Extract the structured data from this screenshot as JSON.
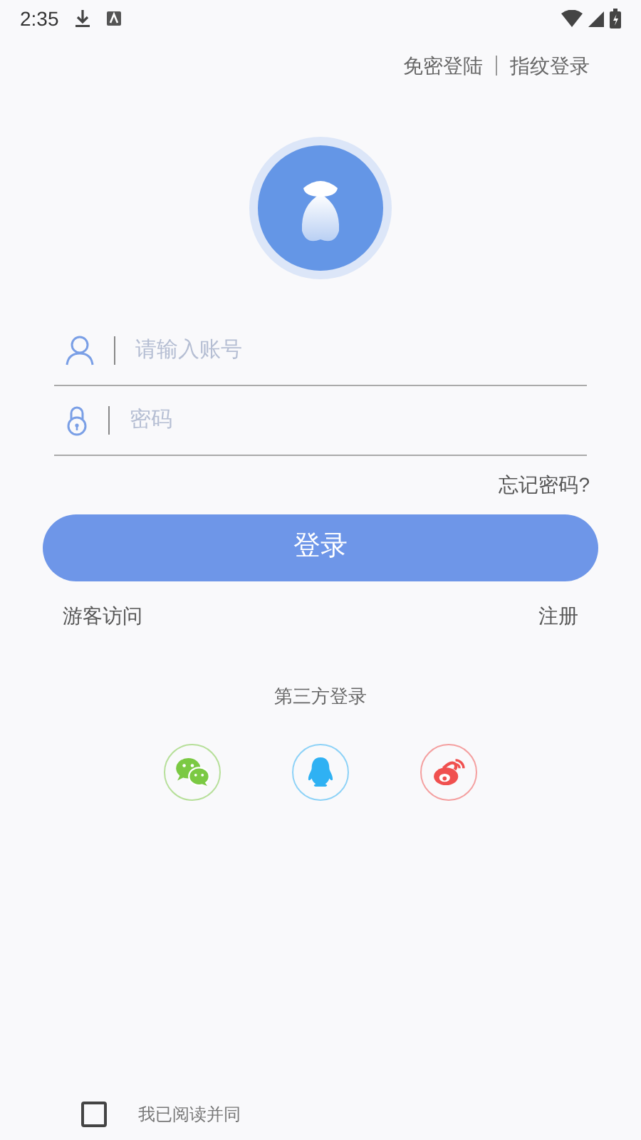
{
  "status_bar": {
    "time": "2:35"
  },
  "top_links": [
    "免密登陆",
    "指纹登录"
  ],
  "fields": [
    {
      "kind": "account",
      "placeholder": "请输入账号"
    },
    {
      "kind": "password",
      "placeholder": "密码"
    }
  ],
  "forgot_link": "忘记密码?",
  "login_button": "登录",
  "guest_link": "游客访问",
  "register_link": "注册",
  "third_party": {
    "title": "第三方登录",
    "providers": [
      {
        "kind": "wechat",
        "color": "#7bc943"
      },
      {
        "kind": "qq",
        "color": "#2fb1f3"
      },
      {
        "kind": "weibo",
        "color": "#f0504f"
      }
    ]
  },
  "agreement": {
    "checked": false,
    "text": "我已阅读并同"
  }
}
